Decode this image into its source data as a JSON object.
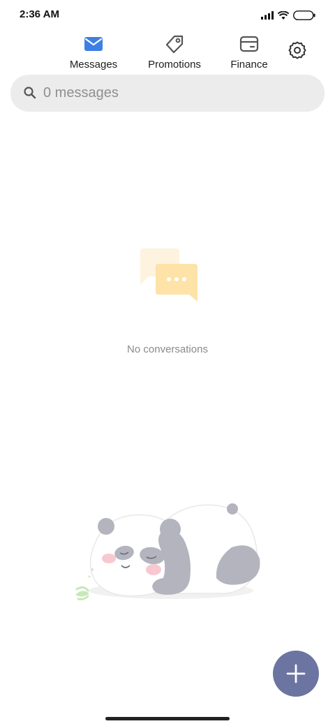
{
  "status_bar": {
    "time": "2:36 AM"
  },
  "nav": {
    "tabs": [
      {
        "label": "Messages",
        "icon": "envelope-icon",
        "active": true
      },
      {
        "label": "Promotions",
        "icon": "tag-icon",
        "active": false
      },
      {
        "label": "Finance",
        "icon": "card-icon",
        "active": false
      }
    ],
    "settings_icon": "gear-icon"
  },
  "search": {
    "placeholder": "0 messages"
  },
  "empty_state": {
    "text": "No conversations"
  },
  "fab": {
    "icon": "plus-icon"
  },
  "colors": {
    "accent": "#3d7fe6",
    "fab": "#6c74a1",
    "search_bg": "#ececec"
  }
}
